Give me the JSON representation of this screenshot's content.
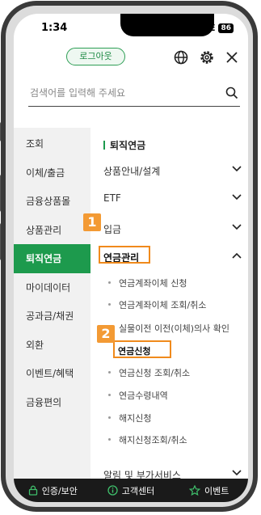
{
  "status": {
    "time": "1:34",
    "network": "LTE",
    "battery": "86"
  },
  "header": {
    "logout_label": "로그아웃",
    "icons": [
      "globe-icon",
      "gear-icon",
      "close-icon"
    ]
  },
  "search": {
    "placeholder": "검색어를 입력해 주세요",
    "icon": "search-icon"
  },
  "sidebar": {
    "items": [
      {
        "label": "조회"
      },
      {
        "label": "이체/출금"
      },
      {
        "label": "금융상품몰"
      },
      {
        "label": "상품관리"
      },
      {
        "label": "퇴직연금",
        "active": true
      },
      {
        "label": "마이데이터"
      },
      {
        "label": "공과금/채권"
      },
      {
        "label": "외환"
      },
      {
        "label": "이벤트/혜택"
      },
      {
        "label": "금융편의"
      }
    ]
  },
  "content": {
    "section_title": "퇴직연금",
    "accordions": [
      {
        "label": "상품안내/설계"
      },
      {
        "label": "ETF"
      },
      {
        "label": "입금"
      },
      {
        "label": "연금관리",
        "open": true
      }
    ],
    "sub_items": [
      {
        "label": "연금계좌이체 신청"
      },
      {
        "label": "연금계좌이체 조회/취소"
      },
      {
        "label": "실물이전 이전(이체)의사 확인"
      },
      {
        "label": "연금신청",
        "selected": true
      },
      {
        "label": "연금신청 조회/취소"
      },
      {
        "label": "연금수령내역"
      },
      {
        "label": "해지신청"
      },
      {
        "label": "해지신청조회/취소"
      }
    ],
    "last_accordion": {
      "label": "알림 및 부가서비스"
    }
  },
  "annotations": {
    "step1": "1",
    "step2": "2",
    "color": "#f08a1c"
  },
  "bottom_bar": {
    "items": [
      {
        "label": "인증/보안",
        "icon": "lock-icon"
      },
      {
        "label": "고객센터",
        "icon": "info-icon"
      },
      {
        "label": "이벤트",
        "icon": "star-icon"
      }
    ]
  },
  "colors": {
    "accent_green": "#1d9a4d",
    "highlight_orange": "#f08a1c",
    "bottom_bar": "#1a1a1a"
  }
}
